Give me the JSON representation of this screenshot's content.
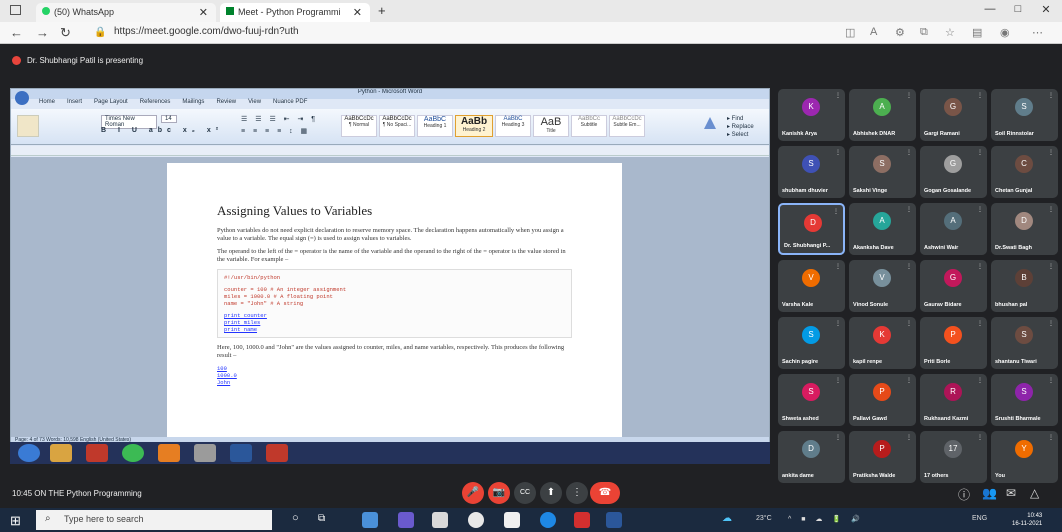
{
  "browser": {
    "tabs": [
      {
        "label": "(50) WhatsApp"
      },
      {
        "label": "Meet - Python Programmi"
      }
    ],
    "new_tab": "+",
    "window_controls": [
      "—",
      "□",
      "✕"
    ],
    "url": "https://meet.google.com/dwo-fuuj-rdn?uth"
  },
  "meet": {
    "presenting_banner": "Dr. Shubhangi Patil is presenting",
    "meeting_info": "10:45 ON THE Python Programming",
    "participants": [
      {
        "name": "Kanishk Arya",
        "initial": "K",
        "color": "#9c27b0"
      },
      {
        "name": "Abhishek DNAR",
        "initial": "A",
        "color": "#4caf50"
      },
      {
        "name": "Gargi Ramani",
        "initial": "G",
        "color": "#795548"
      },
      {
        "name": "Soil Rinnstolar",
        "initial": "S",
        "color": "#607d8b"
      },
      {
        "name": "shubham dhuvier",
        "initial": "S",
        "color": "#3f51b5"
      },
      {
        "name": "Sakshi Vinge",
        "initial": "S",
        "color": "#8d6e63"
      },
      {
        "name": "Gogan Gosalande",
        "initial": "G",
        "color": "#9e9e9e"
      },
      {
        "name": "Chetan Gunjal",
        "initial": "C",
        "color": "#6d4c41"
      },
      {
        "name": "Dr. Shubhangi P...",
        "initial": "D",
        "color": "#e53935"
      },
      {
        "name": "Akanksha Dave",
        "initial": "A",
        "color": "#26a69a"
      },
      {
        "name": "Ashwini Wair",
        "initial": "A",
        "color": "#546e7a"
      },
      {
        "name": "Dr.Swati Bagh",
        "initial": "D",
        "color": "#a1887f"
      },
      {
        "name": "Varsha Kale",
        "initial": "V",
        "color": "#ef6c00"
      },
      {
        "name": "Vinod Sonule",
        "initial": "V",
        "color": "#78909c"
      },
      {
        "name": "Gaurav Bidare",
        "initial": "G",
        "color": "#c2185b"
      },
      {
        "name": "bhushan pal",
        "initial": "B",
        "color": "#5d4037"
      },
      {
        "name": "Sachin pagire",
        "initial": "S",
        "color": "#039be5"
      },
      {
        "name": "kapil renpe",
        "initial": "K",
        "color": "#e53935"
      },
      {
        "name": "Priti Borle",
        "initial": "P",
        "color": "#f4511e"
      },
      {
        "name": "shantanu Tiwari",
        "initial": "S",
        "color": "#6d4c41"
      },
      {
        "name": "Shweta ashed",
        "initial": "S",
        "color": "#d81b60"
      },
      {
        "name": "Pallavi Gawd",
        "initial": "P",
        "color": "#e64a19"
      },
      {
        "name": "Rukhsand Kazmi",
        "initial": "R",
        "color": "#ad1457"
      },
      {
        "name": "Srushti Bharmale",
        "initial": "S",
        "color": "#8e24aa"
      },
      {
        "name": "ankita dame",
        "initial": "D",
        "color": "#607d8b"
      },
      {
        "name": "Pratiksha Walde",
        "initial": "P",
        "color": "#b71c1c"
      },
      {
        "name": "17 others",
        "initial": "17",
        "color": "#5f6368"
      },
      {
        "name": "You",
        "initial": "Y",
        "color": "#ef6c00"
      }
    ]
  },
  "word": {
    "title": "Python - Microsoft Word",
    "tabs": [
      "Home",
      "Insert",
      "Page Layout",
      "References",
      "Mailings",
      "Review",
      "View",
      "Nuance PDF"
    ],
    "font_name": "Times New Roman",
    "font_size": "14",
    "styles": [
      {
        "preview": "AaBbCcDc",
        "name": "¶ Normal"
      },
      {
        "preview": "AaBbCcDc",
        "name": "¶ No Spaci..."
      },
      {
        "preview": "AaBbC",
        "name": "Heading 1"
      },
      {
        "preview": "AaBb",
        "name": "Heading 2"
      },
      {
        "preview": "AaBbC",
        "name": "Heading 3"
      },
      {
        "preview": "AaB",
        "name": "Title"
      },
      {
        "preview": "AaBbCc",
        "name": "Subtitle"
      },
      {
        "preview": "AaBbCcDc",
        "name": "Subtle Em..."
      }
    ],
    "doc": {
      "heading": "Assigning Values to Variables",
      "p1": "Python variables do not need explicit declaration to reserve memory space. The declaration happens automatically when you assign a value to a variable. The equal sign (=) is used to assign values to variables.",
      "p2": "The operand to the left of the = operator is the name of the variable and the operand to the right of the = operator is the value stored in the variable. For example –",
      "code_head": "#!/usr/bin/python",
      "code": [
        "counter = 100          # An integer assignment",
        "miles   = 1000.0       # A floating point",
        "name    = \"John\"       # A string"
      ],
      "prints": [
        "print counter",
        "print miles",
        "print name"
      ],
      "p3": "Here, 100, 1000.0 and \"John\" are the values assigned to counter, miles, and name variables, respectively. This produces the following result –",
      "results": [
        "100",
        "1000.0",
        "John"
      ]
    },
    "status": "Page: 4 of 73   Words: 10,598   English (United States)"
  },
  "controls": {
    "mic": "🎤",
    "cam": "📷",
    "cc": "CC",
    "present": "⬆",
    "more": "⋮",
    "hangup": "☎"
  },
  "taskbar": {
    "search_placeholder": "Type here to search",
    "weather": "23°C",
    "time": "10:43",
    "date": "16-11-2021",
    "lang": "ENG"
  }
}
